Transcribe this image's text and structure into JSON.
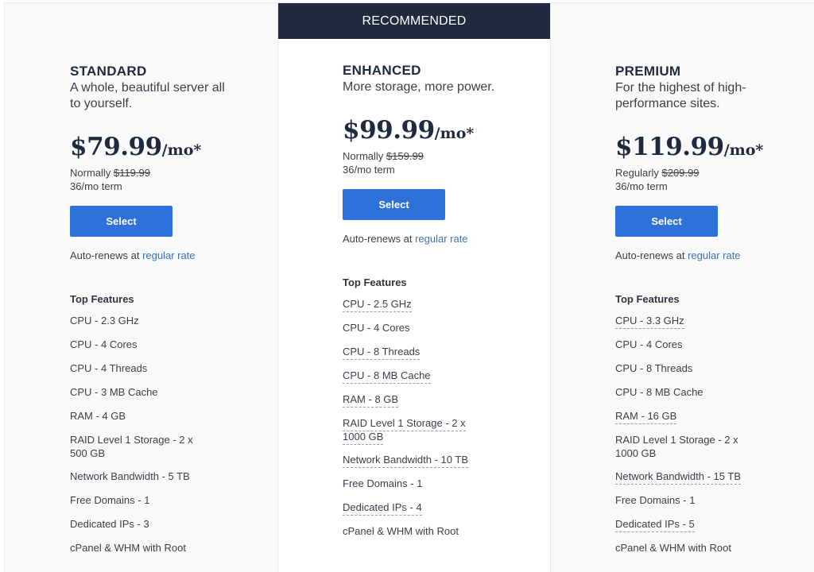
{
  "recommended_label": "RECOMMENDED",
  "plans": [
    {
      "name": "STANDARD",
      "tagline": "A whole, beautiful server all to yourself.",
      "price": "$79.99",
      "unit": "/mo*",
      "normal_label": "Normally",
      "normal_price": "$119.99",
      "term": "36/mo term",
      "select_label": "Select",
      "autorenew_text": "Auto-renews at",
      "autorenew_link": "regular rate",
      "features_title": "Top Features",
      "features": [
        {
          "text": "CPU - 2.3 GHz",
          "dotted": false
        },
        {
          "text": "CPU - 4 Cores",
          "dotted": false
        },
        {
          "text": "CPU - 4 Threads",
          "dotted": false
        },
        {
          "text": "CPU - 3 MB Cache",
          "dotted": false
        },
        {
          "text": "RAM - 4 GB",
          "dotted": false
        },
        {
          "text": "RAID Level 1 Storage - 2 x 500 GB",
          "dotted": false
        },
        {
          "text": "Network Bandwidth - 5 TB",
          "dotted": false
        },
        {
          "text": "Free Domains - 1",
          "dotted": false
        },
        {
          "text": "Dedicated IPs - 3",
          "dotted": false
        },
        {
          "text": "cPanel & WHM with Root",
          "dotted": false
        }
      ]
    },
    {
      "name": "ENHANCED",
      "tagline": "More storage, more power.",
      "price": "$99.99",
      "unit": "/mo*",
      "normal_label": "Normally",
      "normal_price": "$159.99",
      "term": "36/mo term",
      "select_label": "Select",
      "autorenew_text": "Auto-renews at",
      "autorenew_link": "regular rate",
      "features_title": "Top Features",
      "features": [
        {
          "text": "CPU - 2.5 GHz",
          "dotted": true
        },
        {
          "text": "CPU - 4 Cores",
          "dotted": false
        },
        {
          "text": "CPU - 8 Threads",
          "dotted": true
        },
        {
          "text": "CPU - 8 MB Cache",
          "dotted": true
        },
        {
          "text": "RAM - 8 GB",
          "dotted": true
        },
        {
          "text": "RAID Level 1 Storage - 2 x 1000 GB",
          "dotted": true
        },
        {
          "text": "Network Bandwidth - 10 TB",
          "dotted": true
        },
        {
          "text": "Free Domains - 1",
          "dotted": false
        },
        {
          "text": "Dedicated IPs - 4",
          "dotted": true
        },
        {
          "text": "cPanel & WHM with Root",
          "dotted": false
        }
      ]
    },
    {
      "name": "PREMIUM",
      "tagline": "For the highest of high-performance sites.",
      "price": "$119.99",
      "unit": "/mo*",
      "normal_label": "Regularly",
      "normal_price": "$209.99",
      "term": "36/mo term",
      "select_label": "Select",
      "autorenew_text": "Auto-renews at",
      "autorenew_link": "regular rate",
      "features_title": "Top Features",
      "features": [
        {
          "text": "CPU - 3.3 GHz",
          "dotted": true
        },
        {
          "text": "CPU - 4 Cores",
          "dotted": false
        },
        {
          "text": "CPU - 8 Threads",
          "dotted": false
        },
        {
          "text": "CPU - 8 MB Cache",
          "dotted": false
        },
        {
          "text": "RAM - 16 GB",
          "dotted": true
        },
        {
          "text": "RAID Level 1 Storage - 2 x 1000 GB",
          "dotted": false
        },
        {
          "text": "Network Bandwidth - 15 TB",
          "dotted": true
        },
        {
          "text": "Free Domains - 1",
          "dotted": false
        },
        {
          "text": "Dedicated IPs - 5",
          "dotted": true
        },
        {
          "text": "cPanel & WHM with Root",
          "dotted": false
        }
      ]
    }
  ],
  "colors": {
    "navy": "#1f2a3e",
    "select_blue": "#2e72d9",
    "link_blue": "#3d72b8",
    "side_card_bg": "#f9f9f9"
  }
}
